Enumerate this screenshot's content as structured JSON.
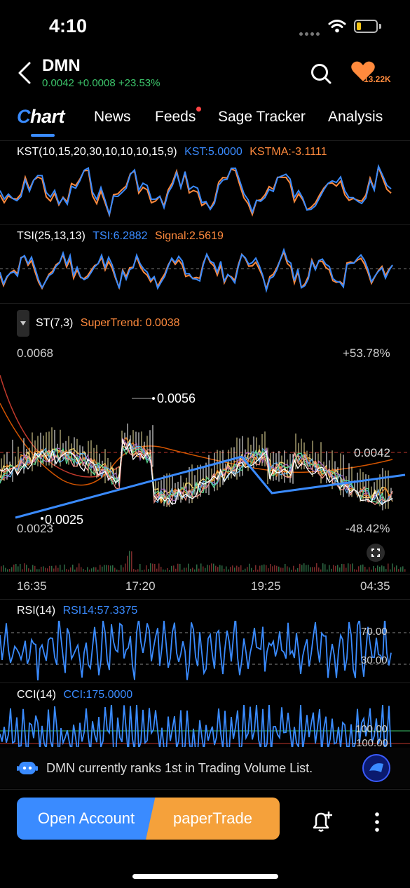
{
  "status": {
    "time": "4:10"
  },
  "header": {
    "ticker": "DMN",
    "quote": "0.0042 +0.0008 +23.53%",
    "fav_count": "13.22K"
  },
  "tabs": [
    {
      "label": "Chart"
    },
    {
      "label": "News"
    },
    {
      "label": "Feeds"
    },
    {
      "label": "Sage Tracker"
    },
    {
      "label": "Analysis"
    }
  ],
  "kst": {
    "name": "KST(10,15,20,30,10,10,10,15,9)",
    "value": "KST:5.0000",
    "ma": "KSTMA:-3.1111"
  },
  "tsi": {
    "name": "TSI(25,13,13)",
    "value": "TSI:6.2882",
    "signal": "Signal:2.5619"
  },
  "st": {
    "name": "ST(7,3)",
    "value": "SuperTrend: 0.0038"
  },
  "main_chart": {
    "high_price": "0.0068",
    "low_price": "0.0023",
    "high_pct": "+53.78%",
    "low_pct": "-48.42%",
    "peak_marker": "0.0056",
    "trough_marker": "0.0025",
    "current_marker": "0.0042",
    "time_labels": [
      "16:35",
      "17:20",
      "19:25",
      "04:35"
    ]
  },
  "rsi": {
    "name": "RSI(14)",
    "value": "RSI14:57.3375",
    "upper": "70.00",
    "lower": "30.00"
  },
  "cci": {
    "name": "CCI(14)",
    "value": "CCI:175.0000",
    "upper": "100.00",
    "lower": "-100.00"
  },
  "rank_banner": {
    "text": "DMN currently ranks 1st in Trading Volume List."
  },
  "actions": {
    "open_account": "Open Account",
    "paper_trade": "paperTrade"
  },
  "colors": {
    "accent_blue": "#3a8bff",
    "accent_orange": "#ff8a3d",
    "up_green": "#3cc46a",
    "paper_orange": "#f5a13b"
  }
}
